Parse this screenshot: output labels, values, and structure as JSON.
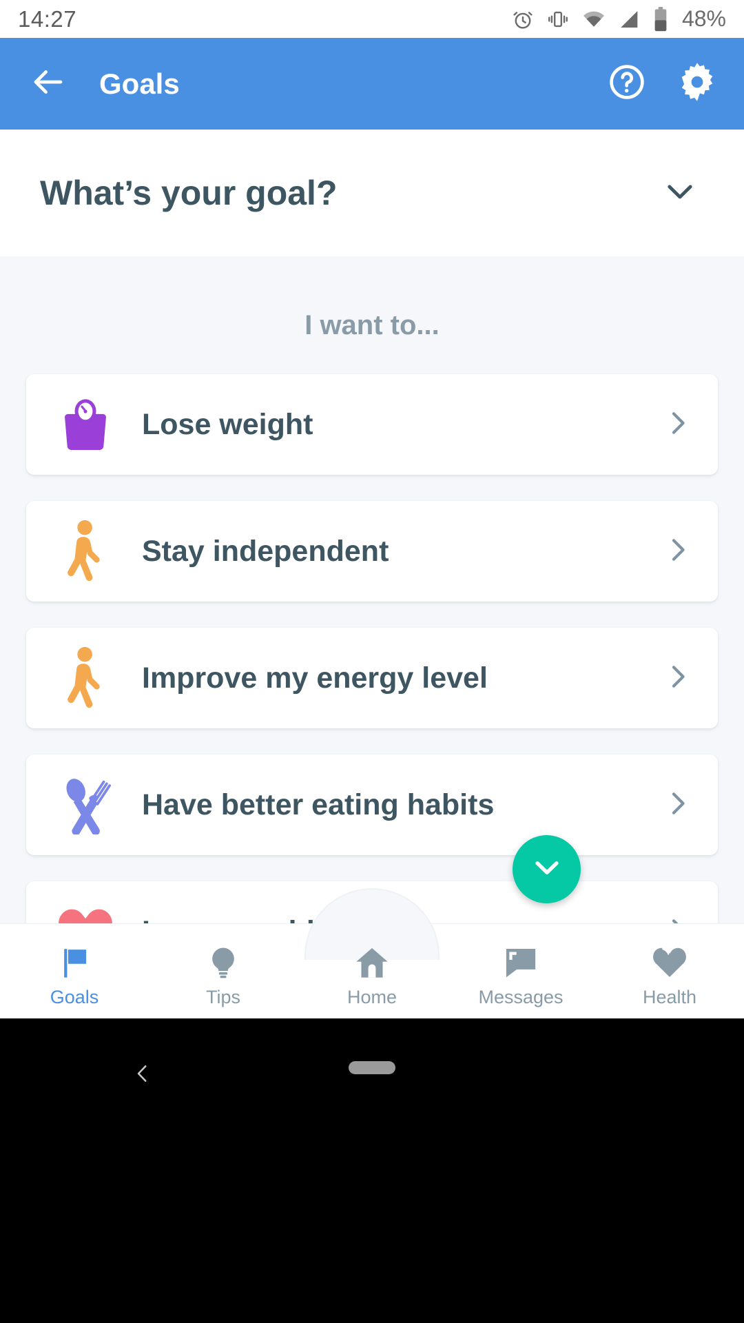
{
  "status_bar": {
    "time": "14:27",
    "battery_percent": "48%",
    "icons": [
      "alarm-icon",
      "vibrate-icon",
      "wifi-icon",
      "cellular-signal-icon",
      "battery-icon"
    ]
  },
  "app_bar": {
    "title": "Goals",
    "back_icon": "back-arrow-icon",
    "help_icon": "help-circle-icon",
    "settings_icon": "gear-icon",
    "background_color": "#4a90e2"
  },
  "question_header": {
    "title": "What’s your goal?",
    "collapse_icon": "chevron-down-icon"
  },
  "main": {
    "subtitle": "I want to...",
    "goals": [
      {
        "label": "Lose weight",
        "icon": "weight-scale-icon",
        "color": "#9b3fd9"
      },
      {
        "label": "Stay independent",
        "icon": "walking-person-icon",
        "color": "#f5a94e"
      },
      {
        "label": "Improve my energy level",
        "icon": "walking-person-icon",
        "color": "#f5a94e"
      },
      {
        "label": "Have better eating habits",
        "icon": "fork-spoon-icon",
        "color": "#7b88e8"
      },
      {
        "label": "Lower my blood pressure",
        "icon": "heartbeat-icon",
        "color": "#f4737f"
      }
    ],
    "row_chevron_icon": "chevron-right-icon"
  },
  "fab": {
    "icon": "chevron-down-icon",
    "color": "#05c9a5"
  },
  "bottom_nav": {
    "active_color": "#4a90e2",
    "inactive_color": "#8a9ba8",
    "items": [
      {
        "label": "Goals",
        "icon": "flag-icon",
        "active": true
      },
      {
        "label": "Tips",
        "icon": "lightbulb-icon",
        "active": false
      },
      {
        "label": "Home",
        "icon": "home-icon",
        "active": false
      },
      {
        "label": "Messages",
        "icon": "speech-bubble-icon",
        "active": false
      },
      {
        "label": "Health",
        "icon": "heart-icon",
        "active": false
      }
    ]
  },
  "android_nav": {
    "back_icon": "system-back-icon",
    "home_pill": "home-pill-handle"
  }
}
